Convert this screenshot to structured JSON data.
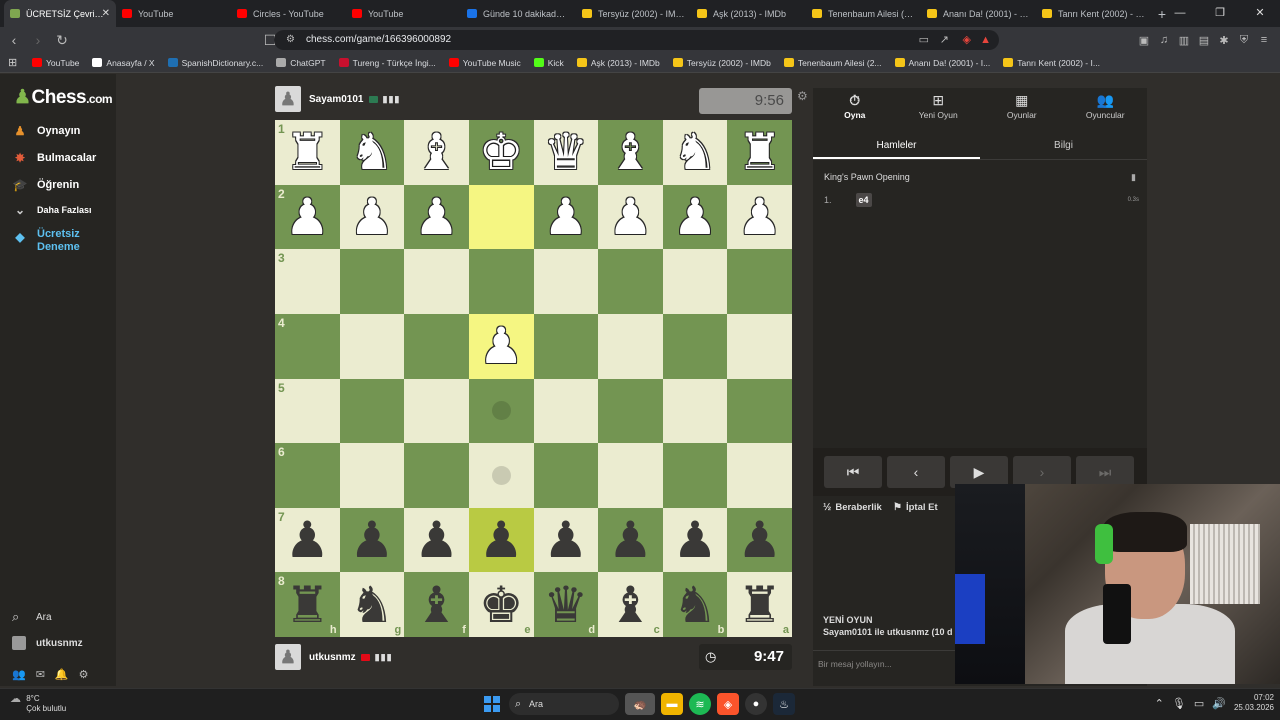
{
  "browser": {
    "tabs": [
      {
        "title": "ÜCRETSİZ Çevrimiçi",
        "favicon": "chess",
        "active": true
      },
      {
        "title": "YouTube",
        "favicon": "youtube"
      },
      {
        "title": "Circles - YouTube",
        "favicon": "youtube"
      },
      {
        "title": "YouTube",
        "favicon": "youtube"
      },
      {
        "title": "Günde 10 dakikada ye",
        "favicon": "google"
      },
      {
        "title": "Tersyüz (2002) - IMDb",
        "favicon": "imdb"
      },
      {
        "title": "Aşk (2013) - IMDb",
        "favicon": "imdb"
      },
      {
        "title": "Tenenbaum Ailesi (200",
        "favicon": "imdb"
      },
      {
        "title": "Ananı Da! (2001) - IMD",
        "favicon": "imdb"
      },
      {
        "title": "Tanrı Kent (2002) - IMD",
        "favicon": "imdb"
      }
    ],
    "url": "chess.com/game/166396000892",
    "bookmarks": [
      {
        "label": "YouTube",
        "color": "#ff0000"
      },
      {
        "label": "Anasayfa / X",
        "color": "#ffffff"
      },
      {
        "label": "SpanishDictionary.c...",
        "color": "#1f6fb2"
      },
      {
        "label": "ChatGPT",
        "color": "#aaaaaa"
      },
      {
        "label": "Tureng - Türkçe İngi...",
        "color": "#c8102e"
      },
      {
        "label": "YouTube Music",
        "color": "#ff0000"
      },
      {
        "label": "Kick",
        "color": "#53fc18"
      },
      {
        "label": "Aşk (2013) - IMDb",
        "color": "#f5c518"
      },
      {
        "label": "Tersyüz (2002) - IMDb",
        "color": "#f5c518"
      },
      {
        "label": "Tenenbaum Ailesi (2...",
        "color": "#f5c518"
      },
      {
        "label": "Ananı Da! (2001) - I...",
        "color": "#f5c518"
      },
      {
        "label": "Tanrı Kent (2002) - I...",
        "color": "#f5c518"
      }
    ]
  },
  "sidebar": {
    "logo_main": "Chess",
    "logo_suffix": ".com",
    "nav": [
      {
        "label": "Oynayın",
        "icon": "play-icon",
        "color": "#e6912c"
      },
      {
        "label": "Bulmacalar",
        "icon": "puzzle-icon",
        "color": "#e25c3a"
      },
      {
        "label": "Öğrenin",
        "icon": "learn-icon",
        "color": "#3a9ad9"
      },
      {
        "label": "Daha Fazlası",
        "icon": "chevron-down-icon",
        "color": "#cccccc"
      }
    ],
    "trial_label_1": "Ücretsiz",
    "trial_label_2": "Deneme",
    "search_label": "Ara",
    "username": "utkusnmz"
  },
  "game": {
    "top_player": {
      "name": "Sayam0101",
      "flag_color": "#2c7a52"
    },
    "bottom_player": {
      "name": "utkusnmz",
      "flag_color": "#e30a17"
    },
    "top_clock": "9:56",
    "bottom_clock": "9:47",
    "ranks": [
      "1",
      "2",
      "3",
      "4",
      "5",
      "6",
      "7",
      "8"
    ],
    "files": [
      "h",
      "g",
      "f",
      "e",
      "d",
      "c",
      "b",
      "a"
    ],
    "board": [
      [
        "wR",
        "wN",
        "wB",
        "wK",
        "wQ",
        "wB",
        "wN",
        "wR"
      ],
      [
        "wP",
        "wP",
        "wP",
        "",
        "wP",
        "wP",
        "wP",
        "wP"
      ],
      [
        "",
        "",
        "",
        "",
        "",
        "",
        "",
        ""
      ],
      [
        "",
        "",
        "",
        "wP",
        "",
        "",
        "",
        ""
      ],
      [
        "",
        "",
        "",
        "",
        "",
        "",
        "",
        ""
      ],
      [
        "",
        "",
        "",
        "",
        "",
        "",
        "",
        ""
      ],
      [
        "bP",
        "bP",
        "bP",
        "bP",
        "bP",
        "bP",
        "bP",
        "bP"
      ],
      [
        "bR",
        "bN",
        "bB",
        "bK",
        "bQ",
        "bB",
        "bN",
        "bR"
      ]
    ],
    "highlighted": [
      [
        1,
        3
      ],
      [
        3,
        3
      ],
      [
        6,
        3
      ]
    ],
    "hints": [
      [
        4,
        3
      ],
      [
        5,
        3
      ]
    ]
  },
  "panel": {
    "tabs": [
      {
        "label": "Oyna",
        "icon": "stopwatch-icon"
      },
      {
        "label": "Yeni Oyun",
        "icon": "plus-icon"
      },
      {
        "label": "Oyunlar",
        "icon": "board-icon"
      },
      {
        "label": "Oyuncular",
        "icon": "players-icon"
      }
    ],
    "subtabs": [
      "Hamleler",
      "Bilgi"
    ],
    "opening": "King's Pawn Opening",
    "move_number": "1.",
    "move_white": "e4",
    "move_time": "0.3s",
    "draw_label": "Beraberlik",
    "abort_label": "İptal Et",
    "newgame_title": "YENİ OYUN",
    "newgame_desc": "Sayam0101 ile utkusnmz (10 dk",
    "chat_placeholder": "Bir mesaj yollayın..."
  },
  "taskbar": {
    "temperature": "8°C",
    "weather": "Çok bulutlu",
    "search": "Ara",
    "time": "07:02",
    "date": "25.03.2026"
  }
}
